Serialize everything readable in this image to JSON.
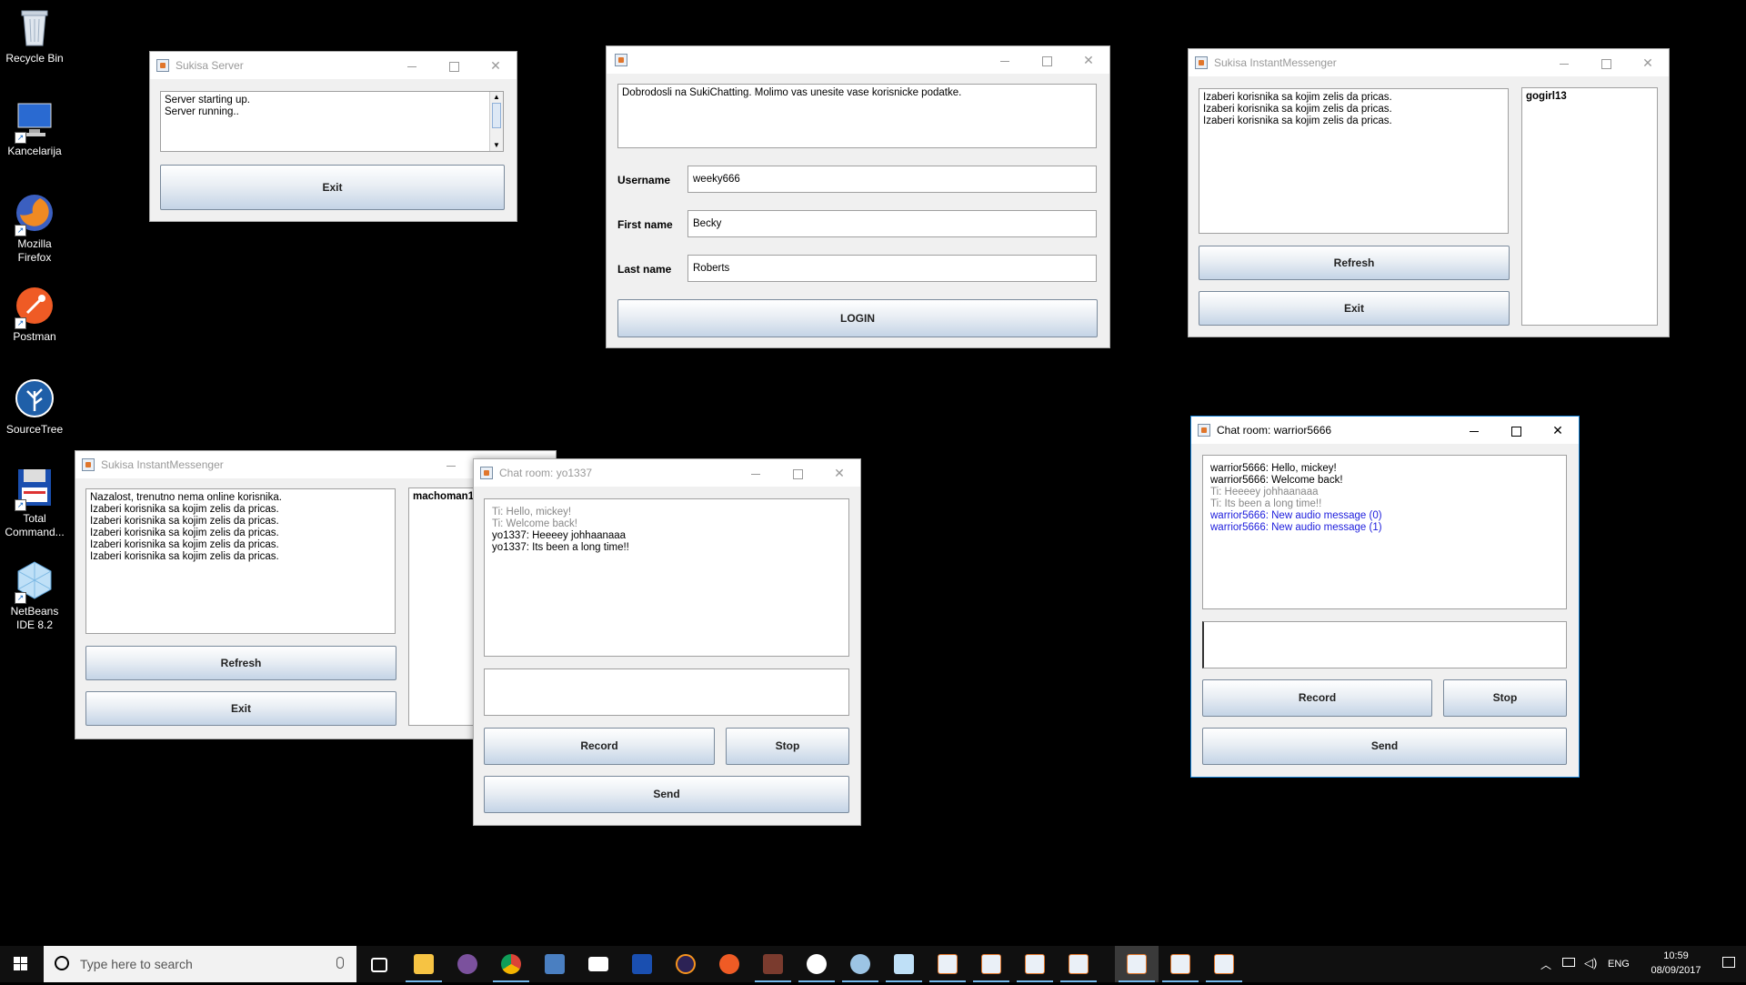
{
  "desktop": {
    "icons": [
      {
        "label": "Recycle Bin",
        "icon": "recycle-bin-icon"
      },
      {
        "label": "Kancelarija",
        "icon": "computer-icon"
      },
      {
        "label": "Mozilla Firefox",
        "icon": "firefox-icon"
      },
      {
        "label": "Postman",
        "icon": "postman-icon"
      },
      {
        "label": "SourceTree",
        "icon": "sourcetree-icon"
      },
      {
        "label": "Total Command...",
        "icon": "total-commander-icon"
      },
      {
        "label": "NetBeans IDE 8.2",
        "icon": "netbeans-icon"
      }
    ]
  },
  "server_window": {
    "title": "Sukisa Server",
    "log": [
      "Server starting up.",
      "Server running.."
    ],
    "exit_label": "Exit"
  },
  "login_window": {
    "title": "",
    "message": "Dobrodosli na SukiChatting. Molimo vas unesite vase korisnicke podatke.",
    "username_label": "Username",
    "username_value": "weeky666",
    "firstname_label": "First name",
    "firstname_value": "Becky",
    "lastname_label": "Last name",
    "lastname_value": "Roberts",
    "login_label": "LOGIN"
  },
  "messenger_right": {
    "title": "Sukisa InstantMessenger",
    "messages": [
      "Izaberi korisnika sa kojim zelis da pricas.",
      "Izaberi korisnika sa kojim zelis da pricas.",
      "Izaberi korisnika sa kojim zelis da pricas."
    ],
    "users": [
      "gogirl13"
    ],
    "refresh_label": "Refresh",
    "exit_label": "Exit"
  },
  "messenger_left": {
    "title": "Sukisa InstantMessenger",
    "messages": [
      "Nazalost, trenutno nema online korisnika.",
      "Izaberi korisnika sa kojim zelis da pricas.",
      "Izaberi korisnika sa kojim zelis da pricas.",
      "Izaberi korisnika sa kojim zelis da pricas.",
      "Izaberi korisnika sa kojim zelis da pricas.",
      "Izaberi korisnika sa kojim zelis da pricas."
    ],
    "users": [
      "machoman1"
    ],
    "refresh_label": "Refresh",
    "exit_label": "Exit"
  },
  "chat_yo": {
    "title": "Chat room: yo1337",
    "messages": [
      {
        "text": "Ti: Hello, mickey!",
        "style": "gray"
      },
      {
        "text": "Ti: Welcome back!",
        "style": "gray"
      },
      {
        "text": "yo1337: Heeeey johhaanaaa",
        "style": "normal"
      },
      {
        "text": "yo1337: Its been a long time!!",
        "style": "normal"
      }
    ],
    "input_value": "",
    "record_label": "Record",
    "stop_label": "Stop",
    "send_label": "Send"
  },
  "chat_warrior": {
    "title": "Chat room: warrior5666",
    "messages": [
      {
        "text": "warrior5666: Hello, mickey!",
        "style": "normal"
      },
      {
        "text": "warrior5666: Welcome back!",
        "style": "normal"
      },
      {
        "text": "Ti: Heeeey johhaanaaa",
        "style": "gray"
      },
      {
        "text": "Ti: Its been a long time!!",
        "style": "gray"
      },
      {
        "text": "warrior5666: New audio message (0)",
        "style": "blue"
      },
      {
        "text": "warrior5666: New audio message (1)",
        "style": "blue"
      }
    ],
    "input_value": "",
    "record_label": "Record",
    "stop_label": "Stop",
    "send_label": "Send"
  },
  "taskbar": {
    "search_placeholder": "Type here to search",
    "pinned": [
      "task-view-icon",
      "file-explorer-icon",
      "viber-icon",
      "chrome-icon",
      "virtualbox-icon",
      "mail-icon",
      "total-commander-icon",
      "eclipse-icon",
      "postman-icon",
      "game-icon",
      "slack-icon",
      "paint-icon",
      "netbeans-icon",
      "java-icon",
      "java-icon",
      "java-icon",
      "java-icon",
      "java-icon",
      "java-icon",
      "java-icon"
    ],
    "language": "ENG",
    "time": "10:59",
    "date": "08/09/2017"
  },
  "colors": {
    "desktop": "#000000",
    "accent": "#1883d7",
    "blue_message": "#2020dd"
  }
}
